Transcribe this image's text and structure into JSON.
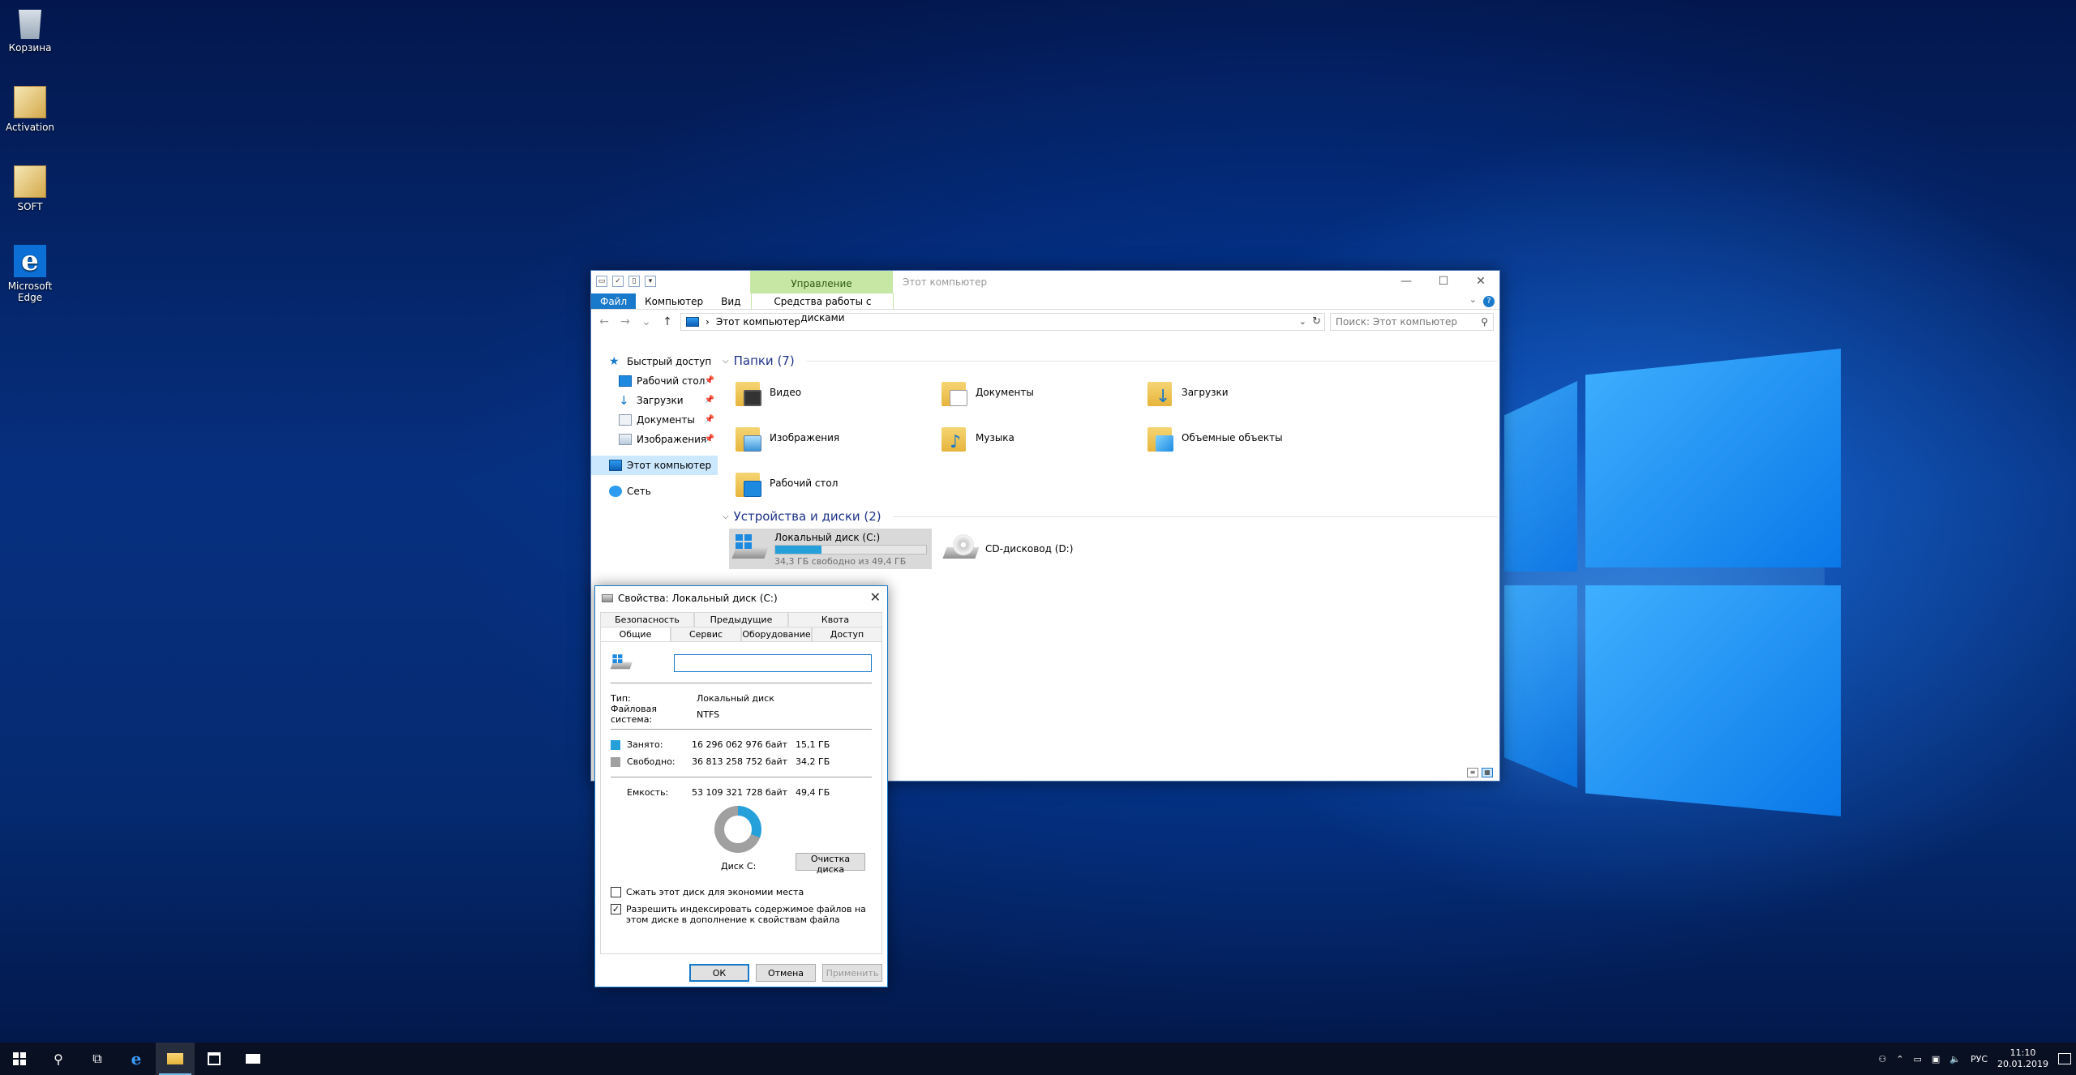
{
  "desktop": {
    "icons": [
      {
        "label": "Корзина",
        "icon": "recycle-bin-icon"
      },
      {
        "label": "Activation",
        "icon": "activation-box-icon"
      },
      {
        "label": "SOFT",
        "icon": "soft-box-icon"
      },
      {
        "label": "Microsoft Edge",
        "icon": "edge-icon"
      }
    ]
  },
  "explorer": {
    "title": "Этот компьютер",
    "context_group": "Управление",
    "ribbon_tabs": [
      "Файл",
      "Компьютер",
      "Вид"
    ],
    "context_tab": "Средства работы с дисками",
    "help_glyph": "?",
    "address": "Этот компьютер",
    "search_placeholder": "Поиск: Этот компьютер",
    "nav": {
      "quick_access": "Быстрый доступ",
      "quick_items": [
        "Рабочий стол",
        "Загрузки",
        "Документы",
        "Изображения"
      ],
      "this_pc": "Этот компьютер",
      "network": "Сеть"
    },
    "folders_header": "Папки (7)",
    "folders": [
      "Видео",
      "Документы",
      "Загрузки",
      "Изображения",
      "Музыка",
      "Объемные объекты",
      "Рабочий стол"
    ],
    "devices_header": "Устройства и диски (2)",
    "drives": [
      {
        "name": "Локальный диск (C:)",
        "free_text": "34,3 ГБ свободно из 49,4 ГБ",
        "used_fraction": 0.306
      },
      {
        "name": "CD-дисковод (D:)"
      }
    ]
  },
  "properties": {
    "title": "Свойства: Локальный диск (C:)",
    "tabs_back": [
      "Безопасность",
      "Предыдущие версии",
      "Квота"
    ],
    "tabs_front": [
      "Общие",
      "Сервис",
      "Оборудование",
      "Доступ"
    ],
    "name_value": "",
    "type_label": "Тип:",
    "type_value": "Локальный диск",
    "fs_label": "Файловая система:",
    "fs_value": "NTFS",
    "used_label": "Занято:",
    "used_bytes": "16 296 062 976 байт",
    "used_gb": "15,1 ГБ",
    "free_label": "Свободно:",
    "free_bytes": "36 813 258 752 байт",
    "free_gb": "34,2 ГБ",
    "capacity_label": "Емкость:",
    "capacity_bytes": "53 109 321 728 байт",
    "capacity_gb": "49,4 ГБ",
    "used_fraction": 0.307,
    "disk_label": "Диск C:",
    "cleanup_button": "Очистка диска",
    "compress_label": "Сжать этот диск для экономии места",
    "compress_checked": false,
    "index_label": "Разрешить индексировать содержимое файлов на этом диске в дополнение к свойствам файла",
    "index_checked": true,
    "ok": "ОК",
    "cancel": "Отмена",
    "apply": "Применить",
    "colors": {
      "used": "#26a0da",
      "free": "#a0a0a0"
    }
  },
  "taskbar": {
    "lang": "РУС",
    "time": "11:10",
    "date": "20.01.2019"
  }
}
